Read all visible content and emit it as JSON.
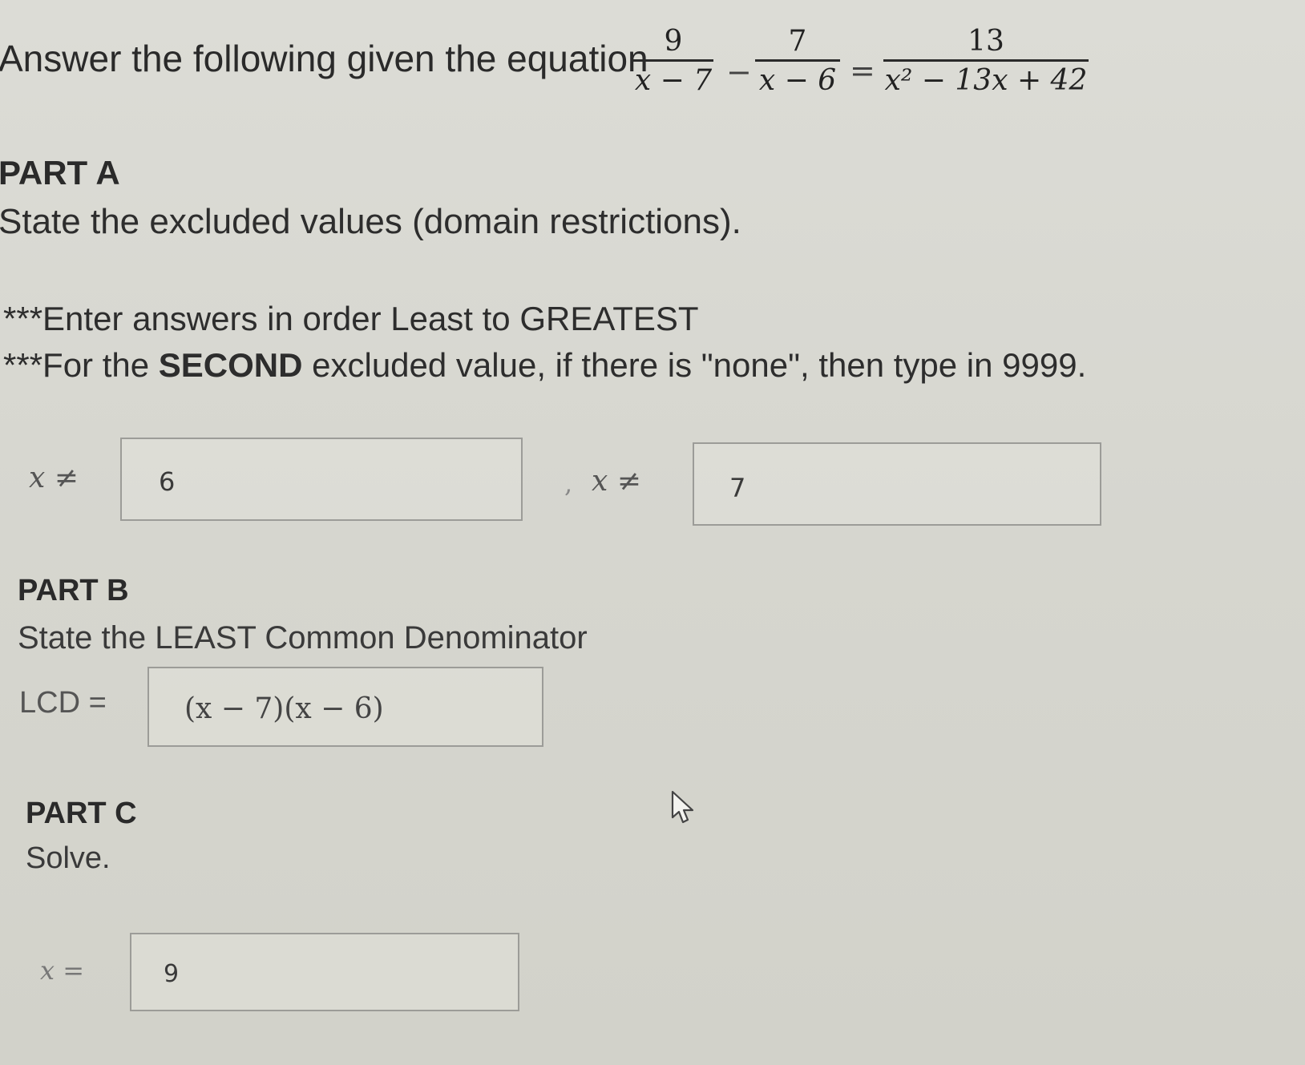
{
  "question": {
    "prompt": "Answer the following given the equation",
    "equation": {
      "term1": {
        "numerator": "9",
        "denominator": "x − 7"
      },
      "operator": "−",
      "term2": {
        "numerator": "7",
        "denominator": "x − 6"
      },
      "equals": "=",
      "term3": {
        "numerator": "13",
        "denominator": "x² − 13x + 42"
      }
    }
  },
  "part_a": {
    "heading": "PART A",
    "prompt": "State the excluded values (domain restrictions).",
    "instruction_1": "***Enter answers in order Least to GREATEST",
    "instruction_2_prefix": "***For the ",
    "instruction_2_bold": "SECOND",
    "instruction_2_suffix": " excluded value, if there is \"none\", then type in 9999.",
    "label_1": "x ≠",
    "separator": ",",
    "label_2": "x ≠",
    "answer_1": "6",
    "answer_2": "7"
  },
  "part_b": {
    "heading": "PART B",
    "prompt": "State the LEAST Common Denominator",
    "label": "LCD =",
    "answer": "(x − 7)(x − 6)"
  },
  "part_c": {
    "heading": "PART C",
    "prompt": "Solve.",
    "label": "x =",
    "answer": "9"
  },
  "icons": {
    "cursor": "mouse-pointer-icon"
  }
}
